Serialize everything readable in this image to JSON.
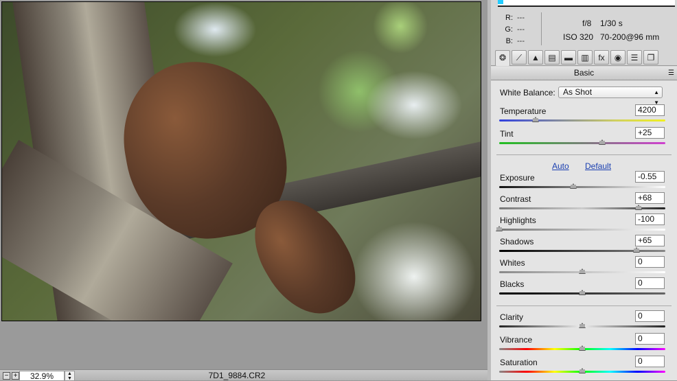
{
  "preview": {
    "zoom": "32.9%",
    "filename": "7D1_9884.CR2",
    "zoom_out": "−",
    "zoom_in": "+"
  },
  "info": {
    "r_label": "R:",
    "g_label": "G:",
    "b_label": "B:",
    "r": "---",
    "g": "---",
    "b": "---",
    "aperture": "f/8",
    "shutter": "1/30 s",
    "iso": "ISO 320",
    "lens": "70-200@96 mm"
  },
  "tabs": [
    {
      "name": "basic",
      "glyph": "❂",
      "active": true
    },
    {
      "name": "tone-curve",
      "glyph": "⟋"
    },
    {
      "name": "detail",
      "glyph": "▲"
    },
    {
      "name": "hsl",
      "glyph": "▤"
    },
    {
      "name": "split-toning",
      "glyph": "▬"
    },
    {
      "name": "lens-corrections",
      "glyph": "▥"
    },
    {
      "name": "effects",
      "glyph": "fx"
    },
    {
      "name": "camera-calibration",
      "glyph": "◉"
    },
    {
      "name": "presets",
      "glyph": "☰"
    },
    {
      "name": "snapshots",
      "glyph": "❐"
    }
  ],
  "panel": {
    "section": "Basic",
    "white_balance_label": "White Balance:",
    "white_balance": "As Shot",
    "auto": "Auto",
    "default": "Default"
  },
  "sliders": [
    {
      "label": "Temperature",
      "value": "4200",
      "position": 0.22,
      "track": "linear-gradient(90deg,#3040e0,#d0d060 70%,#f0f020)"
    },
    {
      "label": "Tint",
      "value": "+25",
      "min": -150,
      "max": 150,
      "num": 25,
      "position": 0.62,
      "track": "linear-gradient(90deg,#20c020,#d040d0)"
    },
    {
      "label": "Exposure",
      "value": "-0.55",
      "min": -5,
      "max": 5,
      "num": -0.55,
      "track": "linear-gradient(90deg,#111,#fff)"
    },
    {
      "label": "Contrast",
      "value": "+68",
      "min": -100,
      "max": 100,
      "num": 68,
      "track": "linear-gradient(90deg,#777,#ccc 50%,#222)"
    },
    {
      "label": "Highlights",
      "value": "-100",
      "min": -100,
      "max": 100,
      "num": -100,
      "track": "linear-gradient(90deg,#777,#fff)"
    },
    {
      "label": "Shadows",
      "value": "+65",
      "min": -100,
      "max": 100,
      "num": 65,
      "track": "linear-gradient(90deg,#000,#888)"
    },
    {
      "label": "Whites",
      "value": "0",
      "min": -100,
      "max": 100,
      "num": 0,
      "track": "linear-gradient(90deg,#888,#fff)"
    },
    {
      "label": "Blacks",
      "value": "0",
      "min": -100,
      "max": 100,
      "num": 0,
      "track": "linear-gradient(90deg,#000,#666)"
    },
    {
      "label": "Clarity",
      "value": "0",
      "min": -100,
      "max": 100,
      "num": 0,
      "track": "linear-gradient(90deg,#222,#eee 50%,#222)"
    },
    {
      "label": "Vibrance",
      "value": "0",
      "min": -100,
      "max": 100,
      "num": 0,
      "track": "linear-gradient(90deg,#888,#f00,#ff0,#0f0,#0ff,#00f,#f0f)"
    },
    {
      "label": "Saturation",
      "value": "0",
      "min": -100,
      "max": 100,
      "num": 0,
      "track": "linear-gradient(90deg,#888,#f00,#ff0,#0f0,#0ff,#00f,#f0f)"
    }
  ]
}
